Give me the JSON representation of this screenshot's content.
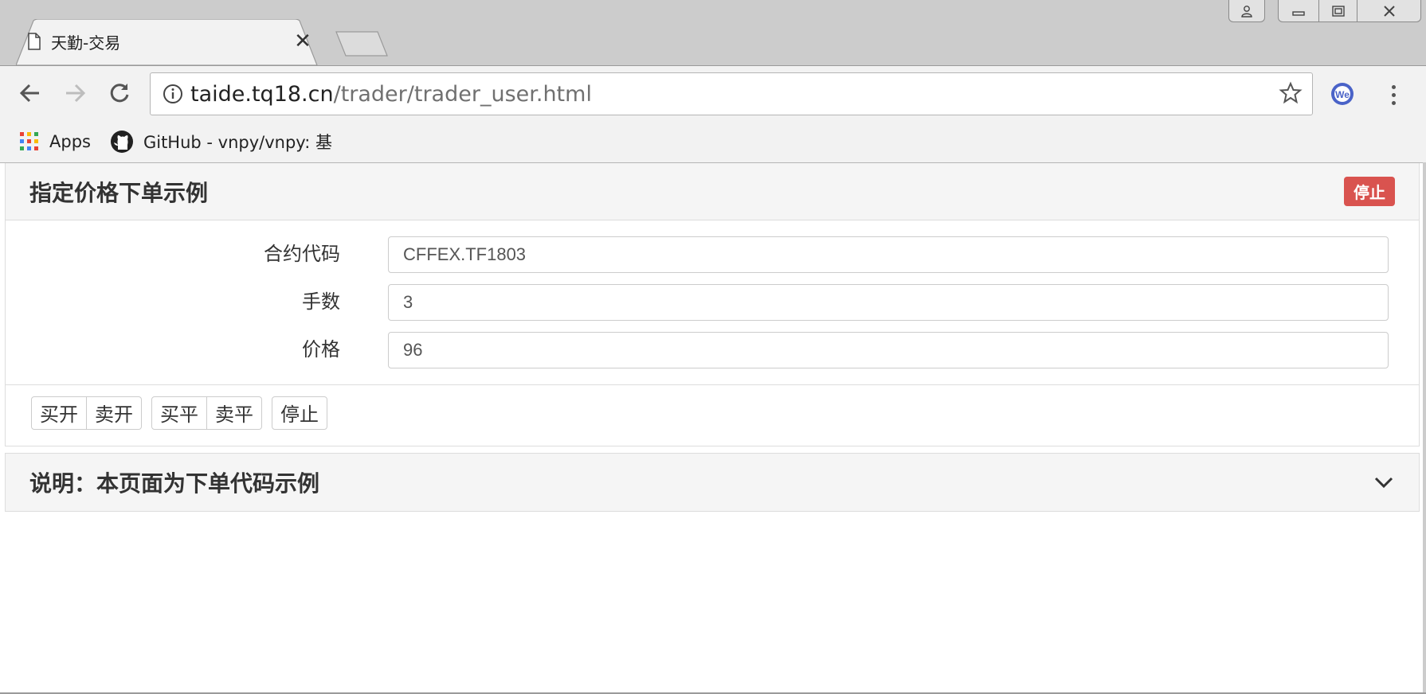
{
  "browser": {
    "tab_title": "天勤-交易",
    "tab_close": "✕",
    "url_host": "taide.tq18.cn",
    "url_path": "/trader/trader_user.html",
    "bookmarks": [
      {
        "label": "Apps",
        "icon": "apps-grid-icon"
      },
      {
        "label": "GitHub - vnpy/vnpy: 基",
        "icon": "github-icon"
      }
    ],
    "ext_icon": "We"
  },
  "order_panel": {
    "title": "指定价格下单示例",
    "status_badge": "停止",
    "fields": [
      {
        "label": "合约代码",
        "value": "CFFEX.TF1803"
      },
      {
        "label": "手数",
        "value": "3"
      },
      {
        "label": "价格",
        "value": "96"
      }
    ],
    "buttons": {
      "buy_open": "买开",
      "sell_open": "卖开",
      "buy_close": "买平",
      "sell_close": "卖平",
      "stop": "停止"
    }
  },
  "note_panel": {
    "title": "说明：本页面为下单代码示例"
  },
  "colors": {
    "badge_red": "#d9534f",
    "panel_header": "#f5f5f5",
    "chrome_gray": "#cccccc"
  }
}
